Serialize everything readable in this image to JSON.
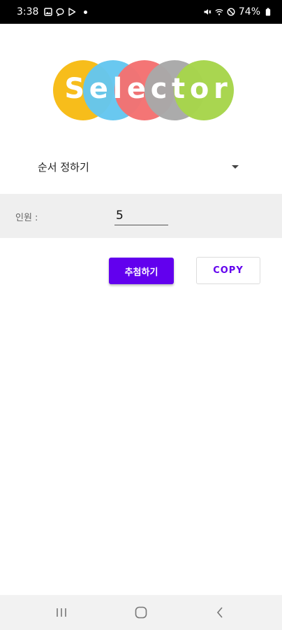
{
  "status_bar": {
    "time": "3:38",
    "battery": "74%",
    "icons_left": [
      "gallery-icon",
      "chat-bubble-icon",
      "play-store-icon",
      "notification-dot"
    ],
    "icons_right": [
      "mute-icon",
      "wifi-icon",
      "do-not-disturb-icon",
      "battery-icon"
    ]
  },
  "logo": {
    "letters": [
      "S",
      "e",
      "l",
      "e",
      "c",
      "t",
      "o",
      "r"
    ],
    "circle_colors": [
      "#f7bb14",
      "#64c6f0",
      "#f47171",
      "#a8a8a8",
      "#a6d54a"
    ]
  },
  "spinner": {
    "selected": "순서 정하기"
  },
  "count": {
    "label": "인원 :",
    "value": "5"
  },
  "buttons": {
    "extract": "추첨하기",
    "copy": "COPY"
  },
  "colors": {
    "accent": "#6200ee"
  },
  "nav_bar": {
    "icons": [
      "recents-icon",
      "home-icon",
      "back-icon"
    ]
  }
}
